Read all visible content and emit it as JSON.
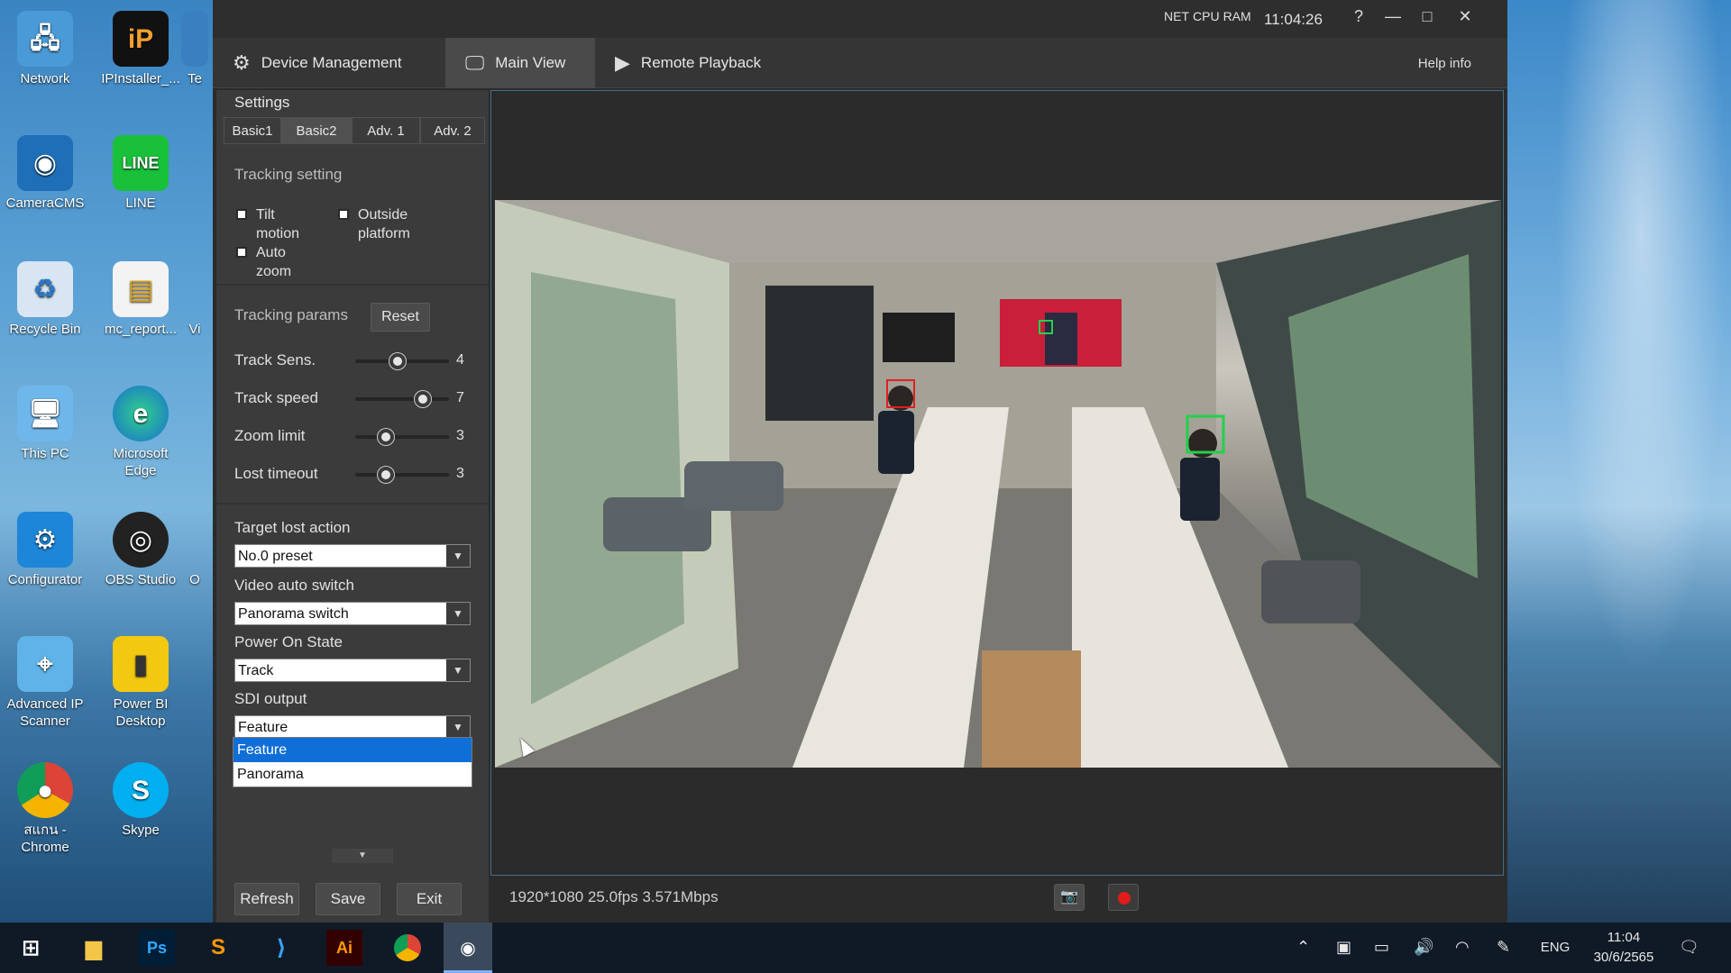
{
  "desktop": {
    "icons": [
      {
        "label": "Network",
        "icon": "network-icon"
      },
      {
        "label": "IPInstaller_...",
        "icon": "ipinstaller-icon"
      },
      {
        "label": "Te",
        "icon": "partial-icon"
      },
      {
        "label": "CameraCMS",
        "icon": "camera-cms-icon"
      },
      {
        "label": "LINE",
        "icon": "line-icon"
      },
      {
        "label": "Recycle Bin",
        "icon": "recycle-bin-icon"
      },
      {
        "label": "mc_report...",
        "icon": "report-icon"
      },
      {
        "label": "Vi",
        "icon": "partial-icon"
      },
      {
        "label": "This PC",
        "icon": "this-pc-icon"
      },
      {
        "label": "Microsoft Edge",
        "icon": "edge-icon"
      },
      {
        "label": "Configurator",
        "icon": "configurator-icon"
      },
      {
        "label": "OBS Studio",
        "icon": "obs-icon"
      },
      {
        "label": "O",
        "icon": "partial-icon"
      },
      {
        "label": "Advanced IP Scanner",
        "icon": "ip-scanner-icon"
      },
      {
        "label": "Power BI Desktop",
        "icon": "powerbi-icon"
      },
      {
        "label": "สแกน - Chrome",
        "icon": "chrome-icon"
      },
      {
        "label": "Skype",
        "icon": "skype-icon"
      }
    ]
  },
  "app": {
    "sysmon": [
      "NET",
      "CPU",
      "RAM"
    ],
    "clock": "11:04:26",
    "window_buttons": {
      "help": "?",
      "minimize": "—",
      "maximize": "□",
      "close": "✕"
    },
    "tabs": [
      {
        "label": "Device Management",
        "icon": "device-management-icon",
        "active": false
      },
      {
        "label": "Main View",
        "icon": "monitor-icon",
        "active": true
      },
      {
        "label": "Remote Playback",
        "icon": "playback-icon",
        "active": false
      }
    ],
    "help_info": "Help info"
  },
  "settings": {
    "title": "Settings",
    "subtabs": [
      {
        "label": "Basic1",
        "active": false
      },
      {
        "label": "Basic2",
        "active": true
      },
      {
        "label": "Adv. 1",
        "active": false
      },
      {
        "label": "Adv. 2",
        "active": false
      }
    ],
    "tracking_setting": {
      "label": "Tracking setting",
      "options": [
        {
          "label": "Tilt motion",
          "checked": false
        },
        {
          "label": "Outside platform",
          "checked": false
        },
        {
          "label": "Auto zoom",
          "checked": false
        }
      ]
    },
    "tracking_params": {
      "label": "Tracking params",
      "reset": "Reset",
      "params": [
        {
          "label": "Track Sens.",
          "value": 4,
          "fraction": 0.45
        },
        {
          "label": "Track speed",
          "value": 7,
          "fraction": 0.72
        },
        {
          "label": "Zoom limit",
          "value": 3,
          "fraction": 0.33
        },
        {
          "label": "Lost timeout",
          "value": 3,
          "fraction": 0.33
        }
      ]
    },
    "selects": [
      {
        "label": "Target lost action",
        "value": "No.0 preset"
      },
      {
        "label": "Video auto switch",
        "value": "Panorama switch"
      },
      {
        "label": "Power On State",
        "value": "Track"
      },
      {
        "label": "SDI output",
        "value": "Feature"
      }
    ],
    "sdi_dropdown_options": [
      {
        "label": "Feature",
        "selected": true
      },
      {
        "label": "Panorama",
        "selected": false
      }
    ],
    "buttons": {
      "refresh": "Refresh",
      "save": "Save",
      "exit": "Exit"
    }
  },
  "video": {
    "status": "1920*1080 25.0fps 3.571Mbps",
    "snapshot_icon": "camera-icon",
    "record_icon": "record-icon",
    "record_color": "#e01b1b",
    "tracking_box_color": "#22d14a",
    "target_box_color": "#e02020"
  },
  "taskbar": {
    "apps": [
      "start-icon",
      "file-explorer-icon",
      "photoshop-icon",
      "sublime-icon",
      "vscode-icon",
      "illustrator-icon",
      "chrome-icon",
      "cms-icon"
    ],
    "lang": "ENG",
    "time": "11:04",
    "date": "30/6/2565"
  }
}
